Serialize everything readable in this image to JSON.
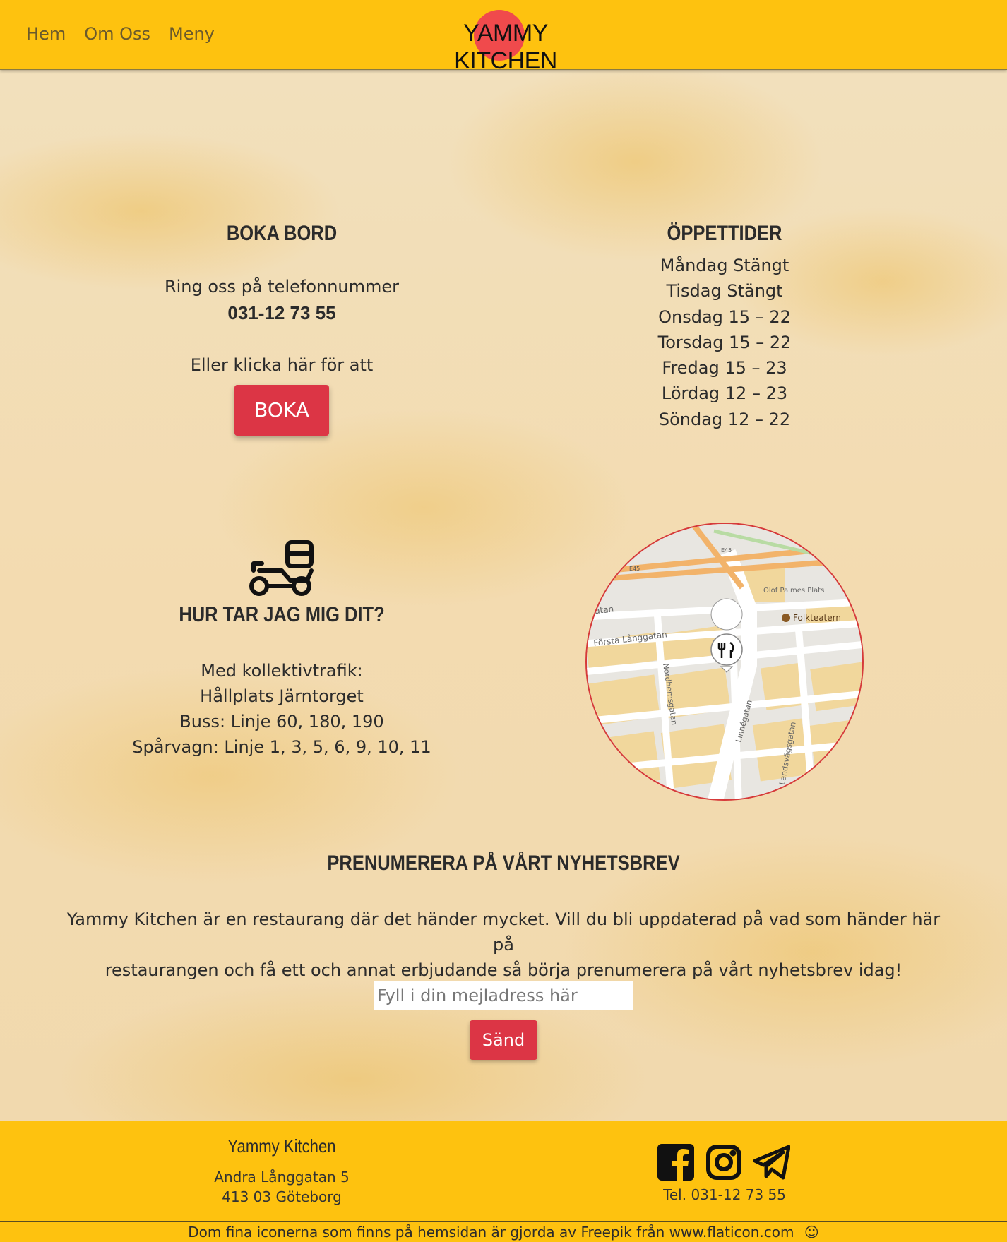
{
  "nav": {
    "items": [
      "Hem",
      "Om Oss",
      "Meny"
    ]
  },
  "logo": {
    "text": "YAMMY KITCHEN"
  },
  "booking": {
    "title": "BOKA BORD",
    "call_text": "Ring oss på telefonnummer",
    "phone": "031-12 73 55",
    "click_text": "Eller klicka här för att",
    "button_label": "BOKA"
  },
  "hours": {
    "title": "ÖPPETTIDER",
    "days": [
      "Måndag Stängt",
      "Tisdag Stängt",
      "Onsdag 15 – 22",
      "Torsdag 15 – 22",
      "Fredag 15 – 23",
      "Lördag 12 – 23",
      "Söndag 12 – 22"
    ]
  },
  "directions": {
    "icon": "scooter-delivery-icon",
    "title": "HUR TAR JAG MIG DIT?",
    "lines": [
      "Med kollektivtrafik:",
      "Hållplats Järntorget",
      "Buss: Linje 60, 180, 190",
      "Spårvagn: Linje 1, 3, 5, 6, 9, 10, 11"
    ]
  },
  "map": {
    "labels": {
      "e45_a": "E45",
      "e45_b": "E45",
      "olof": "Olof Palmes Plats",
      "folkteatern": "Folkteatern",
      "gatan": "gatan",
      "forsta": "Första Långgatan",
      "nordhem": "Nordhemsgatan",
      "linne": "Linnégatan",
      "landsvag": "Landsvägsgatan"
    },
    "marker_icon": "restaurant-pin-icon"
  },
  "newsletter": {
    "title": "PRENUMERERA PÅ VÅRT NYHETSBREV",
    "description_line1": "Yammy Kitchen är en restaurang där det händer mycket. Vill du bli uppdaterad på vad som händer här på",
    "description_line2": "restaurangen och få ett och annat erbjudande så börja prenumerera på vårt nyhetsbrev idag!",
    "email_placeholder": "Fyll i din mejladress här",
    "send_label": "Sänd"
  },
  "footer": {
    "name": "Yammy Kitchen",
    "address_line1": "Andra Långgatan 5",
    "address_line2": "413 03 Göteborg",
    "phone": "Tel. 031-12 73 55",
    "social_icons": [
      "facebook-icon",
      "instagram-icon",
      "telegram-icon"
    ],
    "credit_prefix": "Dom fina iconerna som finns på hemsidan är gjorda av",
    "credit_freepik": "Freepik",
    "credit_from": "från",
    "credit_flaticon": "www.flaticon.com",
    "credit_emoji": "☺"
  },
  "colors": {
    "header_bg": "#fec20f",
    "button_red": "#dc3545",
    "logo_dot": "#f04a4c",
    "page_texture": "#f3dfb4"
  }
}
